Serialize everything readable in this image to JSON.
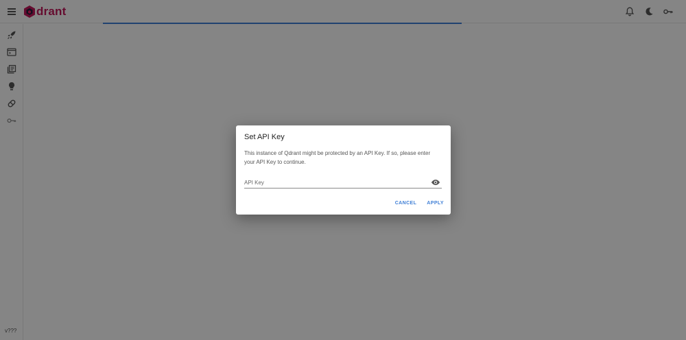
{
  "header": {
    "logo_text": "drant",
    "brand_color": "#c2185b",
    "icons": [
      "menu-icon",
      "bell-icon",
      "moon-icon",
      "key-icon"
    ]
  },
  "sidebar": {
    "items": [
      {
        "name": "rocket-icon"
      },
      {
        "name": "console-icon"
      },
      {
        "name": "collections-icon"
      },
      {
        "name": "lightbulb-icon"
      },
      {
        "name": "pill-icon"
      },
      {
        "name": "key-icon"
      }
    ],
    "version": "v???"
  },
  "dialog": {
    "title": "Set API Key",
    "message": "This instance of Qdrant might be protected by an API Key. If so, please enter your API Key to continue.",
    "input_placeholder": "API Key",
    "input_value": "",
    "cancel_label": "CANCEL",
    "apply_label": "APPLY"
  },
  "colors": {
    "accent": "#3f7fd6",
    "overlay": "rgba(0,0,0,0.48)"
  }
}
